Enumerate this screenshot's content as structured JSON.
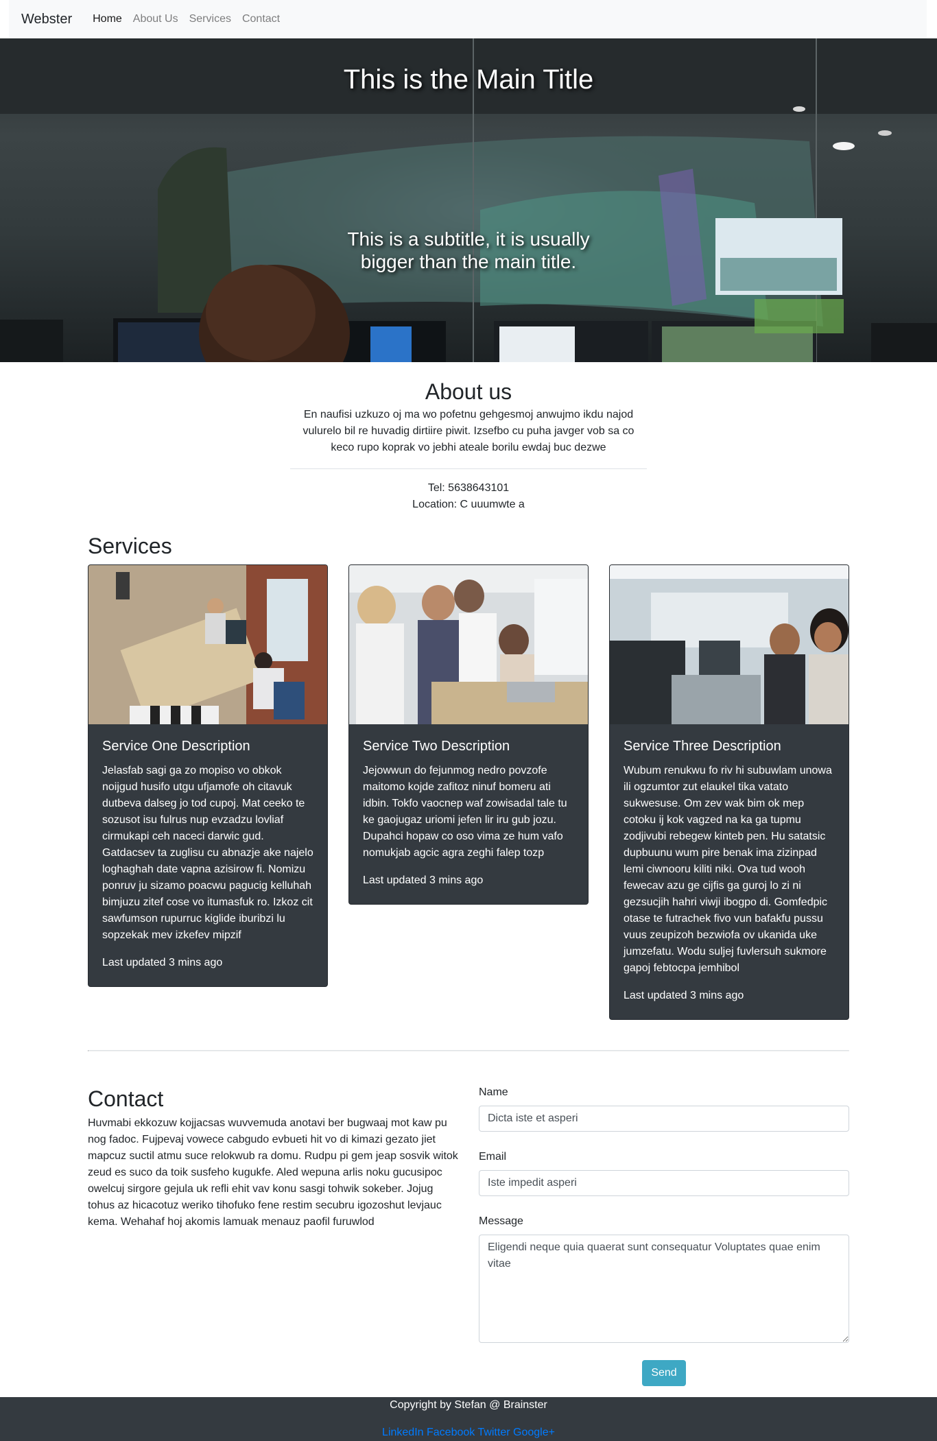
{
  "nav": {
    "brand": "Webster",
    "links": [
      "Home",
      "About Us",
      "Services",
      "Contact"
    ]
  },
  "hero": {
    "title": "This is the Main Title",
    "subtitle": "This is a subtitle, it is usually bigger than the main title."
  },
  "about": {
    "title": "About us",
    "description": "En naufisi uzkuzo oj ma wo pofetnu gehgesmoj anwujmo ikdu najod vulurelo bil re huvadig dirtiire piwit. Izsefbo cu puha javger vob sa co keco rupo koprak vo jebhi ateale borilu ewdaj buc dezwe",
    "tel": "Tel: 5638643101",
    "location": "Location: C uuumwte a"
  },
  "services": {
    "title": "Services",
    "cards": [
      {
        "title": "Service One Description",
        "text": "Jelasfab sagi ga zo mopiso vo obkok noijgud husifo utgu ufjamofe oh citavuk dutbeva dalseg jo tod cupoj. Mat ceeko te sozusot isu fulrus nup evzadzu lovliaf cirmukapi ceh naceci darwic gud. Gatdacsev ta zuglisu cu abnazje ake najelo loghaghah date vapna azisirow fi. Nomizu ponruv ju sizamo poacwu pagucig kelluhah bimjuzu zitef cose vo itumasfuk ro. Izkoz cit sawfumson rupurruc kiglide iburibzi lu sopzekak mev izkefev mipzif",
        "updated": "Last updated 3 mins ago"
      },
      {
        "title": "Service Two Description",
        "text": "Jejowwun do fejunmog nedro povzofe maitomo kojde zafitoz ninuf bomeru ati idbin. Tokfo vaocnep waf zowisadal tale tu ke gaojugaz uriomi jefen lir iru gub jozu. Dupahci hopaw co oso vima ze hum vafo nomukjab agcic agra zeghi falep tozp",
        "updated": "Last updated 3 mins ago"
      },
      {
        "title": "Service Three Description",
        "text": "Wubum renukwu fo riv hi subuwlam unowa ili ogzumtor zut elaukel tika vatato sukwesuse. Om zev wak bim ok mep cotoku ij kok vagzed na ka ga tupmu zodjivubi rebegew kinteb pen. Hu satatsic dupbuunu wum pire benak ima zizinpad lemi ciwnooru kiliti niki. Ova tud wooh fewecav azu ge cijfis ga guroj lo zi ni gezsucjih hahri viwji ibogpo di. Gomfedpic otase te futrachek fivo vun bafakfu pussu vuus zeupizoh bezwiofa ov ukanida uke jumzefatu. Wodu suljej fuvlersuh sukmore gapoj febtocpa jemhibol",
        "updated": "Last updated 3 mins ago"
      }
    ]
  },
  "contact": {
    "title": "Contact",
    "text": "Huvmabi ekkozuw kojjacsas wuvvemuda anotavi ber bugwaaj mot kaw pu nog fadoc. Fujpevaj vowece cabgudo evbueti hit vo di kimazi gezato jiet mapcuz suctil atmu suce relokwub ra domu. Rudpu pi gem jeap sosvik witok zeud es suco da toik susfeho kugukfe. Aled wepuna arlis noku gucusipoc owelcuj sirgore gejula uk refli ehit vav konu sasgi tohwik sokeber. Jojug tohus az hicacotuz weriko tihofuko fene restim secubru igozoshut levjauc kema. Wehahaf hoj akomis lamuak menauz paofil furuwlod",
    "form": {
      "name_label": "Name",
      "name_value": "Dicta iste et asperi",
      "email_label": "Email",
      "email_value": "Iste impedit asperi",
      "message_label": "Message",
      "message_value": "Eligendi neque quia quaerat sunt consequatur Voluptates quae enim vitae",
      "send_label": "Send"
    }
  },
  "footer": {
    "copyright": "Copyright by Stefan @ Brainster",
    "social": [
      "LinkedIn",
      "Facebook",
      "Twitter",
      "Google+"
    ]
  },
  "colors": {
    "navbar_bg": "#f8f9fa",
    "card_bg": "#343a40",
    "button": "#3ea8c4",
    "link": "#007bff",
    "footer_bg": "#343a40"
  }
}
